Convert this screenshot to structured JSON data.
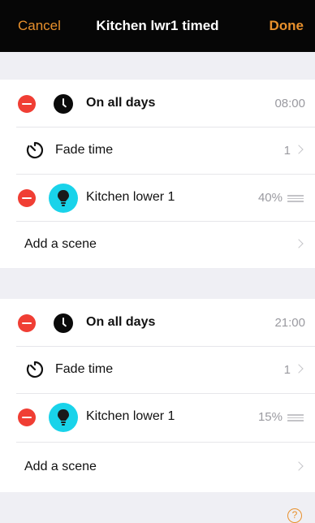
{
  "nav": {
    "cancel_label": "Cancel",
    "title": "Kitchen lwr1 timed",
    "done_label": "Done"
  },
  "blocks": [
    {
      "schedule_label": "On all days",
      "schedule_time": "08:00",
      "fade_label": "Fade time",
      "fade_value": "1",
      "light_label": "Kitchen lower 1",
      "light_level": "40%",
      "add_scene_label": "Add a scene"
    },
    {
      "schedule_label": "On all days",
      "schedule_time": "21:00",
      "fade_label": "Fade time",
      "fade_value": "1",
      "light_label": "Kitchen lower 1",
      "light_level": "15%",
      "add_scene_label": "Add a scene"
    }
  ],
  "help_glyph": "?",
  "colors": {
    "accent": "#e8902c",
    "delete": "#f03e34",
    "bulb": "#19d3ea",
    "nav_bg": "#060606"
  }
}
